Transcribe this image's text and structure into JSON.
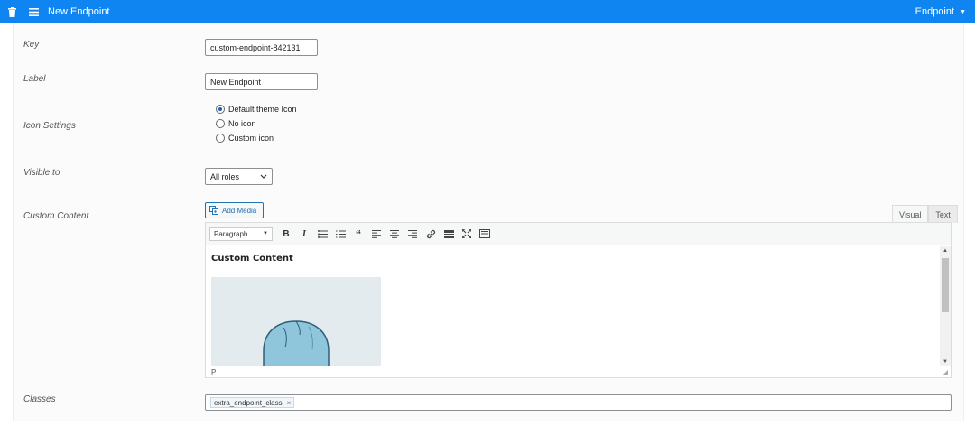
{
  "topbar": {
    "title": "New Endpoint",
    "endpoint_menu_label": "Endpoint",
    "trash_icon": "trash-icon",
    "menu_icon": "hamburger-menu-icon"
  },
  "form": {
    "key_label": "Key",
    "key_value": "custom-endpoint-842131",
    "label_label": "Label",
    "label_value": "New Endpoint",
    "icon_settings_label": "Icon Settings",
    "icon_options": [
      {
        "label": "Default theme Icon",
        "checked": true
      },
      {
        "label": "No icon",
        "checked": false
      },
      {
        "label": "Custom icon",
        "checked": false
      }
    ],
    "visible_to_label": "Visible to",
    "visible_to_value": "All roles",
    "custom_content_label": "Custom Content",
    "classes_label": "Classes",
    "classes_tags": [
      "extra_endpoint_class"
    ]
  },
  "editor": {
    "add_media_label": "Add Media",
    "tab_visual": "Visual",
    "tab_text": "Text",
    "format_value": "Paragraph",
    "heading": "Custom Content",
    "status_path": "P",
    "toolbar_icons": [
      "bold-icon",
      "italic-icon",
      "bullet-list-icon",
      "numbered-list-icon",
      "blockquote-icon",
      "align-left-icon",
      "align-center-icon",
      "align-right-icon",
      "link-icon",
      "read-more-icon",
      "fullscreen-icon",
      "toolbar-toggle-icon"
    ]
  },
  "colors": {
    "topbar": "#0f85f2",
    "accent": "#2271b1"
  }
}
